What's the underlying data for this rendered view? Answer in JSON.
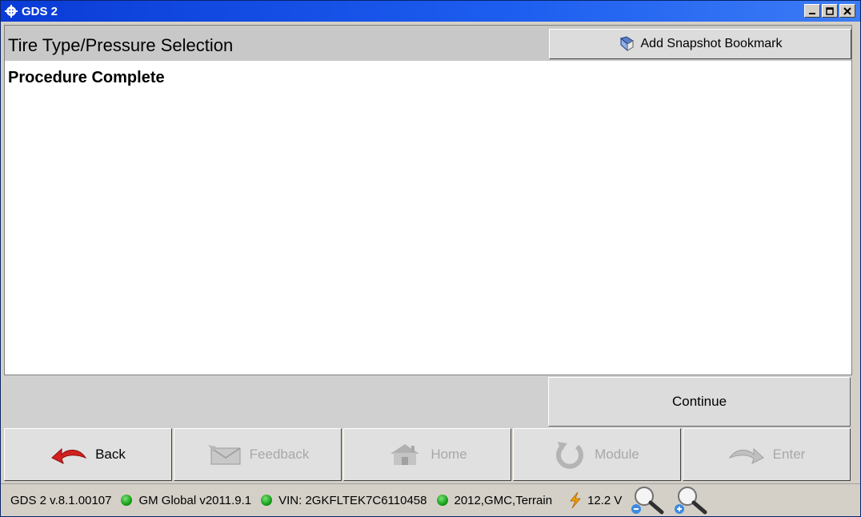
{
  "window": {
    "title": "GDS 2"
  },
  "header": {
    "page_title": "Tire Type/Pressure Selection",
    "bookmark_label": "Add Snapshot Bookmark"
  },
  "content": {
    "message": "Procedure Complete"
  },
  "actions": {
    "continue_label": "Continue"
  },
  "nav": [
    {
      "label": "Back",
      "icon": "back-arrow-icon",
      "enabled": true
    },
    {
      "label": "Feedback",
      "icon": "feedback-envelope-icon",
      "enabled": false
    },
    {
      "label": "Home",
      "icon": "home-icon",
      "enabled": false
    },
    {
      "label": "Module",
      "icon": "module-refresh-icon",
      "enabled": false
    },
    {
      "label": "Enter",
      "icon": "enter-arrow-icon",
      "enabled": false
    }
  ],
  "status": {
    "version": "GDS 2 v.8.1.00107",
    "global": "GM Global v2011.9.1",
    "vin": "VIN: 2GKFLTEK7C6110458",
    "vehicle": "2012,GMC,Terrain",
    "voltage": "12.2 V",
    "colors": {
      "led": "#14a014",
      "back_icon": "#d42020",
      "lightning": "#f0a000"
    }
  }
}
